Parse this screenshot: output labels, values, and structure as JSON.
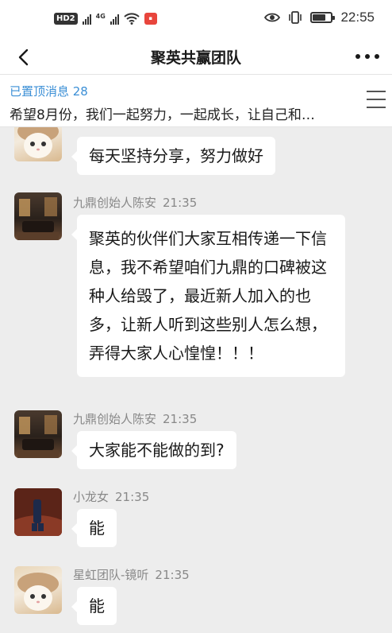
{
  "status_bar": {
    "hd": "HD",
    "hd_index": "2",
    "network": "4G",
    "time": "22:55"
  },
  "nav": {
    "title": "聚英共赢团队",
    "back_icon": "chevron-left-icon",
    "more_icon": "more-horizontal-icon"
  },
  "pinned": {
    "label": "已置顶消息 28",
    "text": "希望8月份，我们一起努力，一起成长，让自己和…"
  },
  "messages": [
    {
      "avatar": "cat-avatar",
      "sender": "",
      "time": "",
      "text": "每天坚持分享，努力做好"
    },
    {
      "avatar": "room-avatar",
      "sender": "九鼎创始人陈安",
      "time": "21:35",
      "text": "聚英的伙伴们大家互相传递一下信息，我不希望咱们九鼎的口碑被这种人给毁了，最近新人加入的也多，让新人听到这些别人怎么想，弄得大家人心惶惶！！！"
    },
    {
      "avatar": "room-avatar",
      "sender": "九鼎创始人陈安",
      "time": "21:35",
      "text": "大家能不能做的到?"
    },
    {
      "avatar": "girl-avatar",
      "sender": "小龙女",
      "time": "21:35",
      "text": "能"
    },
    {
      "avatar": "cat-avatar",
      "sender": "星虹团队-镜听",
      "time": "21:35",
      "text": "能"
    }
  ]
}
